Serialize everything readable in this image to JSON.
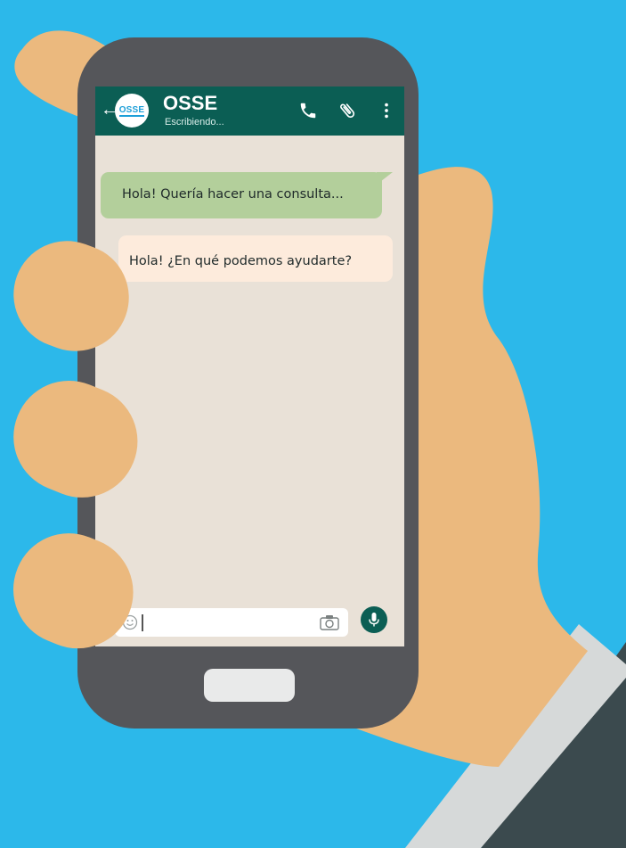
{
  "chat": {
    "contact_name": "OSSE",
    "contact_status": "Escribiendo...",
    "avatar_logo_text": "OSSE",
    "back_glyph": "←"
  },
  "messages": [
    {
      "direction": "outgoing",
      "text": "Hola! Quería hacer una consulta..."
    },
    {
      "direction": "incoming",
      "text": "Hola! ¿En qué podemos ayudarte?"
    }
  ],
  "header_icons": [
    "phone-icon",
    "paperclip-icon",
    "more-vert-icon"
  ],
  "input_icons": [
    "emoji-icon",
    "camera-icon",
    "mic-icon"
  ],
  "colors": {
    "background": "#2cb8ea",
    "header": "#0b5e54",
    "chat_background": "#e9e1d7",
    "outgoing_bubble": "#b3cf9b",
    "incoming_bubble": "#fdebdc",
    "skin": "#ebb97e",
    "phone_body": "#55565a",
    "sleeve": "#3b4a4e",
    "cuff": "#d6d9d9"
  }
}
